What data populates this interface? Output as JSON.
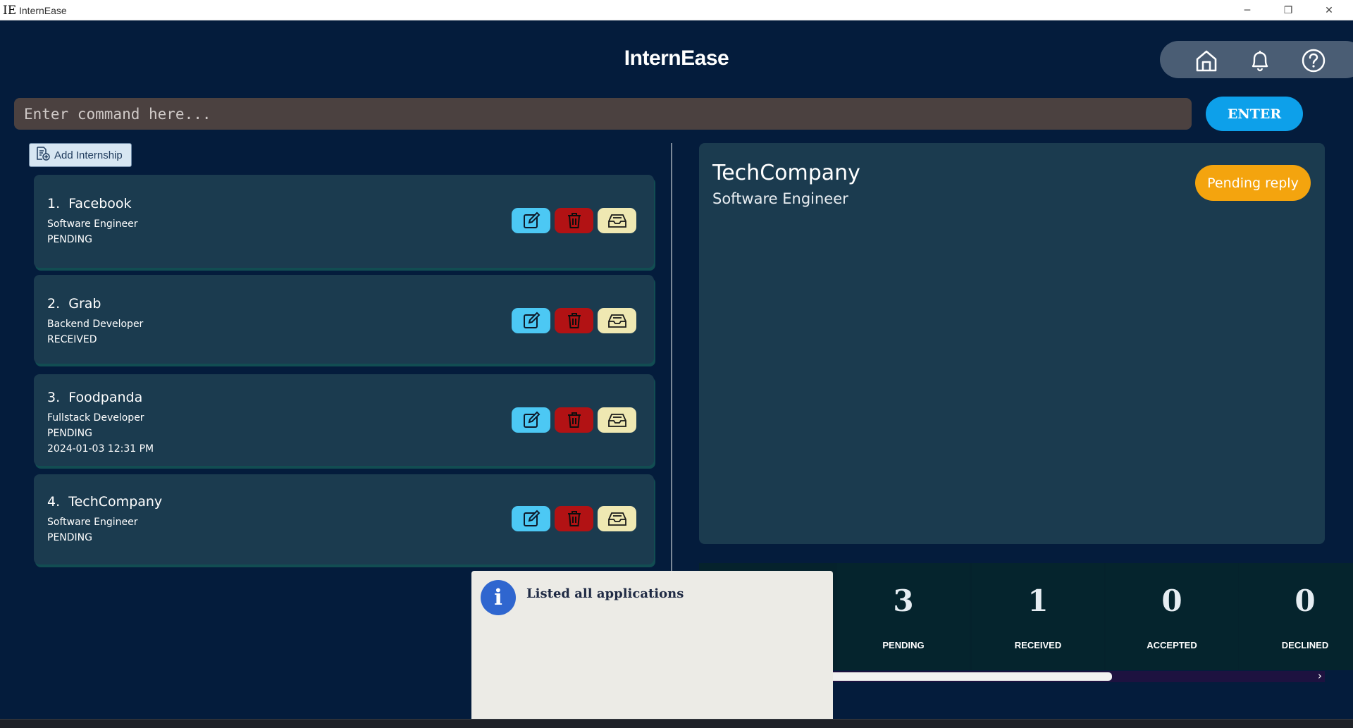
{
  "window": {
    "icon_text": "IE",
    "title": "InternEase",
    "min_glyph": "─",
    "max_glyph": "❐",
    "close_glyph": "✕"
  },
  "header": {
    "title": "InternEase",
    "nav": [
      "home-icon",
      "bell-icon",
      "help-icon"
    ]
  },
  "command": {
    "placeholder": "Enter command here...",
    "value": "",
    "enter_label": "ENTER"
  },
  "add_button": {
    "label": "Add Internship",
    "icon": "add-document-icon"
  },
  "internships": [
    {
      "index": "1.",
      "company": "Facebook",
      "role": "Software Engineer",
      "status": "PENDING",
      "date": ""
    },
    {
      "index": "2.",
      "company": "Grab",
      "role": "Backend Developer",
      "status": "RECEIVED",
      "date": ""
    },
    {
      "index": "3.",
      "company": "Foodpanda",
      "role": "Fullstack Developer",
      "status": "PENDING",
      "date": "2024-01-03 12:31 PM"
    },
    {
      "index": "4.",
      "company": "TechCompany",
      "role": "Software Engineer",
      "status": "PENDING",
      "date": ""
    }
  ],
  "card_actions": [
    "edit-icon",
    "trash-icon",
    "archive-icon"
  ],
  "detail": {
    "company": "TechCompany",
    "role": "Software Engineer",
    "status_label": "Pending reply"
  },
  "stats": [
    {
      "value": "3",
      "label": "PENDING"
    },
    {
      "value": "1",
      "label": "RECEIVED"
    },
    {
      "value": "0",
      "label": "ACCEPTED"
    },
    {
      "value": "0",
      "label": "DECLINED"
    }
  ],
  "stats_scroll": {
    "arrow": "›"
  },
  "toast": {
    "message": "Listed all applications",
    "icon_text": "i"
  },
  "colors": {
    "background": "#041c3c",
    "card": "#1b3b4f",
    "enter": "#0da0ea",
    "pending_badge": "#f4a40e",
    "edit": "#4cc8f4",
    "delete": "#b21214",
    "archive": "#efe8b2"
  }
}
